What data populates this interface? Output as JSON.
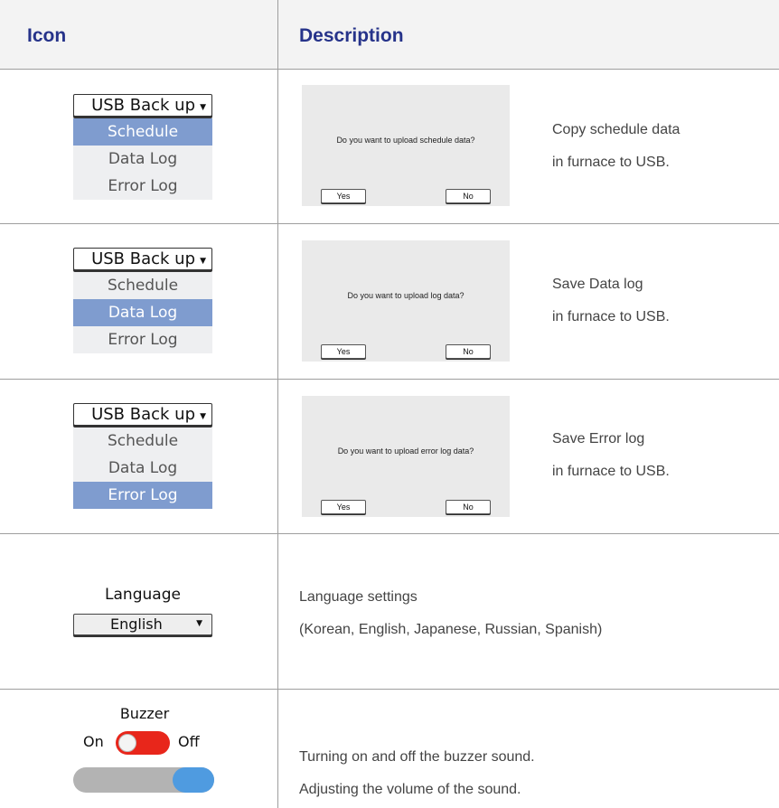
{
  "header": {
    "icon_col": "Icon",
    "desc_col": "Description"
  },
  "rows": [
    {
      "dropdown": {
        "title": "USB Back up",
        "items": [
          "Schedule",
          "Data Log",
          "Error Log"
        ],
        "selected": "Schedule"
      },
      "dialog": {
        "message": "Do you want to upload schedule data?",
        "yes": "Yes",
        "no": "No"
      },
      "desc": [
        "Copy schedule data",
        "in furnace to USB."
      ]
    },
    {
      "dropdown": {
        "title": "USB Back up",
        "items": [
          "Schedule",
          "Data Log",
          "Error Log"
        ],
        "selected": "Data Log"
      },
      "dialog": {
        "message": "Do you want to upload log data?",
        "yes": "Yes",
        "no": "No"
      },
      "desc": [
        "Save Data log",
        "in furnace to USB."
      ]
    },
    {
      "dropdown": {
        "title": "USB Back up",
        "items": [
          "Schedule",
          "Data Log",
          "Error Log"
        ],
        "selected": "Error Log"
      },
      "dialog": {
        "message": "Do you want to upload error log data?",
        "yes": "Yes",
        "no": "No"
      },
      "desc": [
        "Save Error log",
        "in furnace to USB."
      ]
    }
  ],
  "language": {
    "label": "Language",
    "value": "English",
    "desc": [
      "Language settings",
      "(Korean, English, Japanese, Russian, Spanish)"
    ]
  },
  "buzzer": {
    "label": "Buzzer",
    "on_label": "On",
    "off_label": "Off",
    "toggle_state": "on",
    "volume_fraction": 1.0,
    "desc": [
      "Turning on and off the buzzer sound.",
      "Adjusting the volume of the sound."
    ]
  },
  "colors": {
    "header_text": "#26338a",
    "selected_item": "#7f9ccf",
    "toggle": "#e8261b",
    "slider_thumb": "#4f9be0"
  }
}
